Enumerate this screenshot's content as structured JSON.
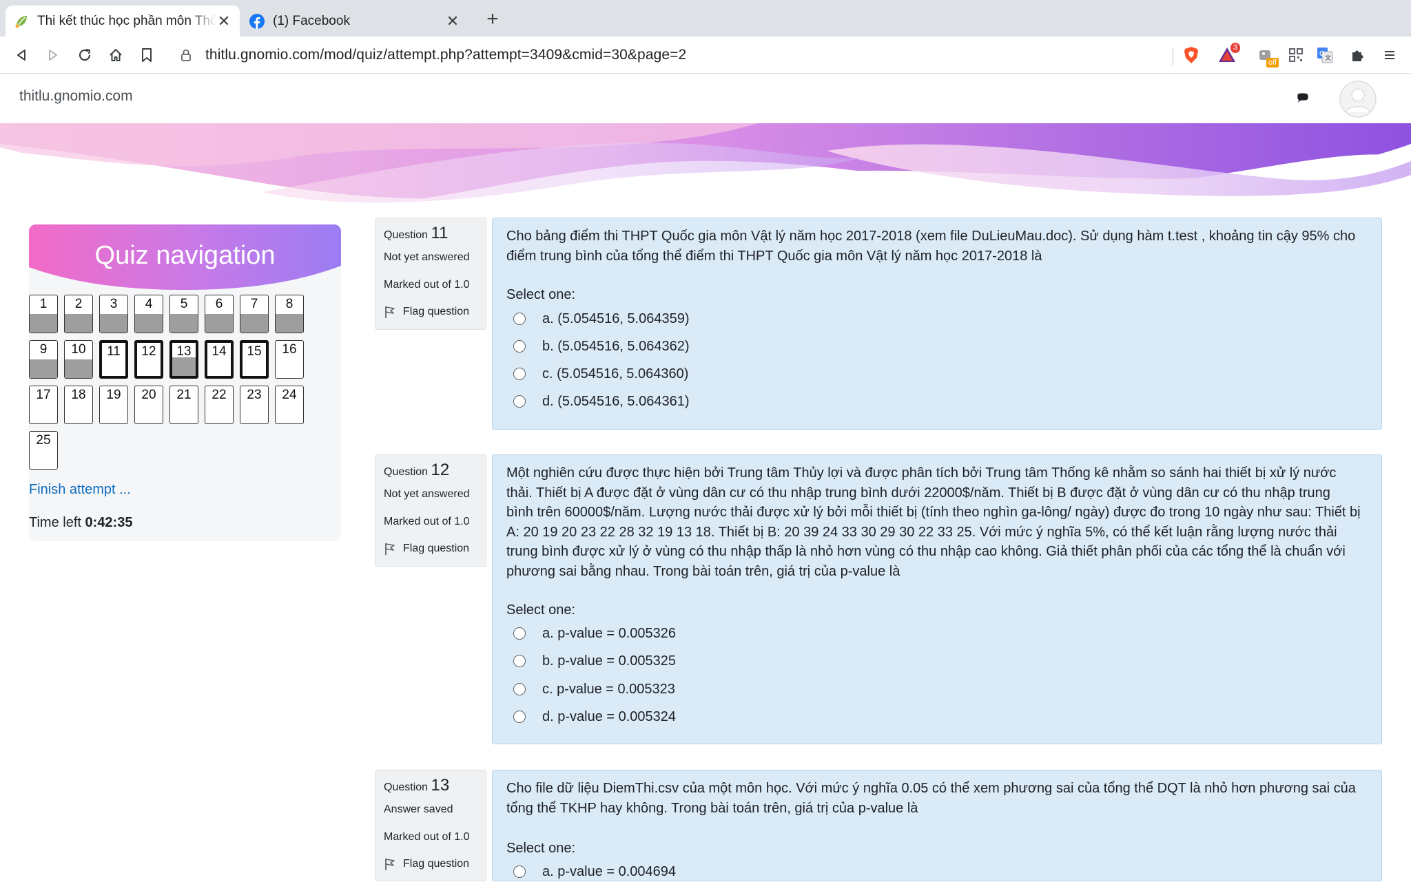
{
  "browser": {
    "tabs": [
      {
        "title": "Thi kết thúc học phần môn Thống kê",
        "favicon": "moodle-leaf-icon",
        "active": true
      },
      {
        "title": "(1) Facebook",
        "favicon": "facebook-icon",
        "active": false
      }
    ],
    "url_host": "thitlu.gnomio.com",
    "url_path": "/mod/quiz/attempt.php?attempt=3409&cmid=30&page=2",
    "extensions": [
      {
        "name": "brave-shield-icon"
      },
      {
        "name": "brave-rewards-icon",
        "badge": "3"
      },
      {
        "name": "honey-extension-icon",
        "badge": "off"
      },
      {
        "name": "qr-code-icon"
      },
      {
        "name": "google-translate-icon"
      },
      {
        "name": "extensions-puzzle-icon"
      },
      {
        "name": "menu-icon"
      }
    ]
  },
  "site": {
    "name": "thitlu.gnomio.com"
  },
  "quiz_nav": {
    "title": "Quiz navigation",
    "buttons": [
      {
        "n": "1",
        "answered": true,
        "current": false
      },
      {
        "n": "2",
        "answered": true,
        "current": false
      },
      {
        "n": "3",
        "answered": true,
        "current": false
      },
      {
        "n": "4",
        "answered": true,
        "current": false
      },
      {
        "n": "5",
        "answered": true,
        "current": false
      },
      {
        "n": "6",
        "answered": true,
        "current": false
      },
      {
        "n": "7",
        "answered": true,
        "current": false
      },
      {
        "n": "8",
        "answered": true,
        "current": false
      },
      {
        "n": "9",
        "answered": true,
        "current": false
      },
      {
        "n": "10",
        "answered": true,
        "current": false
      },
      {
        "n": "11",
        "answered": false,
        "current": true
      },
      {
        "n": "12",
        "answered": false,
        "current": true
      },
      {
        "n": "13",
        "answered": true,
        "current": true
      },
      {
        "n": "14",
        "answered": false,
        "current": true
      },
      {
        "n": "15",
        "answered": false,
        "current": true
      },
      {
        "n": "16",
        "answered": false,
        "current": false
      },
      {
        "n": "17",
        "answered": false,
        "current": false
      },
      {
        "n": "18",
        "answered": false,
        "current": false
      },
      {
        "n": "19",
        "answered": false,
        "current": false
      },
      {
        "n": "20",
        "answered": false,
        "current": false
      },
      {
        "n": "21",
        "answered": false,
        "current": false
      },
      {
        "n": "22",
        "answered": false,
        "current": false
      },
      {
        "n": "23",
        "answered": false,
        "current": false
      },
      {
        "n": "24",
        "answered": false,
        "current": false
      },
      {
        "n": "25",
        "answered": false,
        "current": false
      }
    ],
    "finish_label": "Finish attempt ...",
    "time_left_label": "Time left",
    "time_left_value": "0:42:35"
  },
  "questions": [
    {
      "label": "Question",
      "number": "11",
      "state": "Not yet answered",
      "grade": "Marked out of 1.0",
      "flag_label": "Flag question",
      "text": "Cho bảng điểm thi THPT Quốc gia môn Vật lý năm học 2017-2018 (xem file DuLieuMau.doc). Sử dụng hàm t.test , khoảng tin cậy 95% cho điểm trung bình của tổng thể điểm thi THPT Quốc gia môn Vật lý năm học 2017-2018 là",
      "select_label": "Select one:",
      "options": [
        "a. (5.054516, 5.064359)",
        "b. (5.054516, 5.064362)",
        "c. (5.054516, 5.064360)",
        "d. (5.054516, 5.064361)"
      ]
    },
    {
      "label": "Question",
      "number": "12",
      "state": "Not yet answered",
      "grade": "Marked out of 1.0",
      "flag_label": "Flag question",
      "text": "Một nghiên cứu được thực hiện bởi Trung tâm Thủy lợi và được phân tích bởi Trung tâm Thống kê nhằm so sánh hai thiết bị xử lý nước thải. Thiết bị A được đặt ở vùng dân cư có thu nhập trung bình dưới 22000$/năm. Thiết bị B được đặt ở vùng dân cư có thu nhập trung bình trên 60000$/năm. Lượng nước thải được xử lý bởi mỗi thiết bị (tính theo nghìn ga-lông/ ngày) được đo trong 10 ngày như sau: Thiết bị A: 20 19 20 23 22 28 32 19 13 18. Thiết bị B: 20 39 24 33 30 29 30 22 33 25. Với mức ý nghĩa 5%, có thể kết luận rằng lượng nước thải trung bình được xử lý ở vùng có thu nhập thấp là nhỏ hơn vùng có thu nhập cao không. Giả thiết phân phối của các tổng thể là chuẩn với phương sai bằng nhau. Trong bài toán trên, giá trị của p-value là",
      "select_label": "Select one:",
      "options": [
        "a. p-value = 0.005326",
        "b. p-value = 0.005325",
        "c. p-value = 0.005323",
        "d. p-value = 0.005324"
      ]
    },
    {
      "label": "Question",
      "number": "13",
      "state": "Answer saved",
      "grade": "Marked out of 1.0",
      "flag_label": "Flag question",
      "text": "Cho file dữ liệu DiemThi.csv của một môn học. Với mức ý nghĩa 0.05 có thể xem phương sai của tổng thể DQT là nhỏ hơn phương sai của tổng thể TKHP hay không. Trong bài toán trên, giá trị của p-value là",
      "select_label": "Select one:",
      "options": [
        "a. p-value = 0.004694"
      ]
    }
  ]
}
